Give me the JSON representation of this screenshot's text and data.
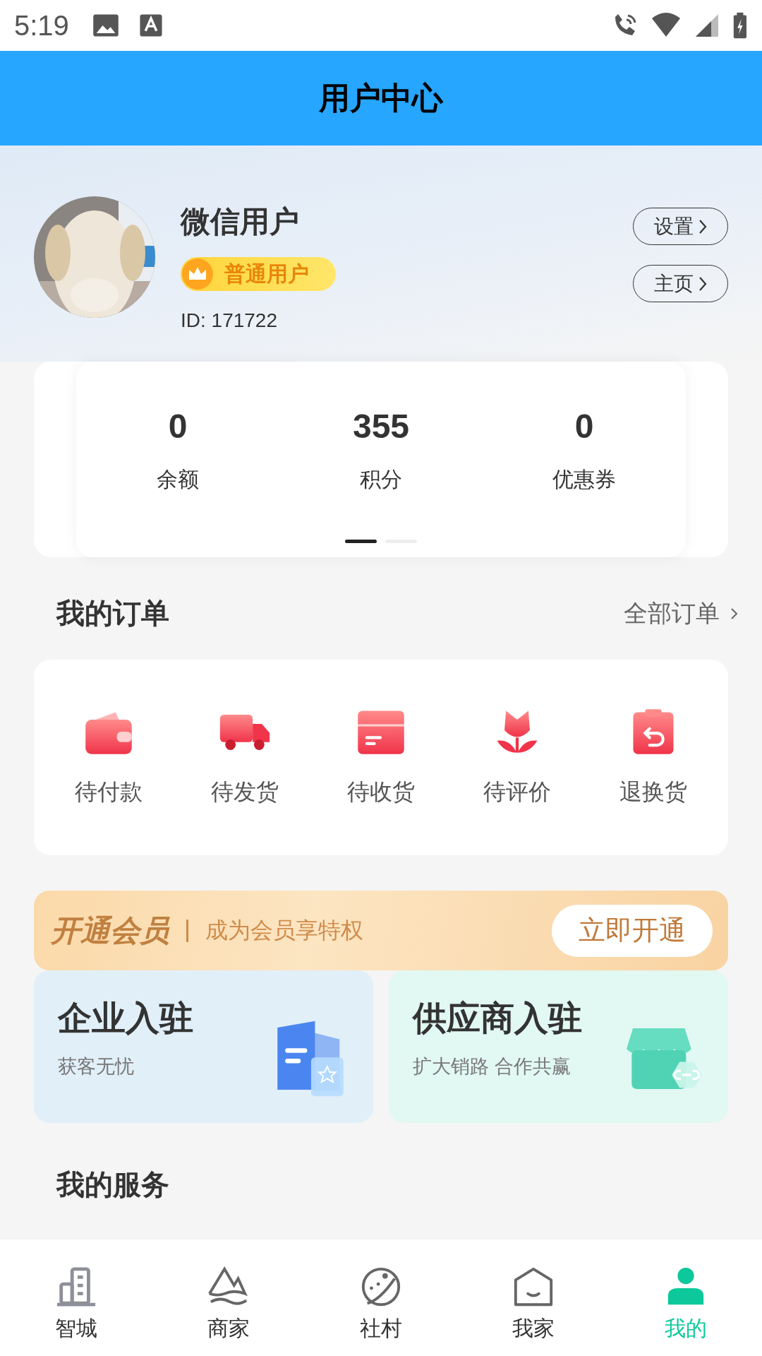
{
  "status_bar": {
    "time": "5:19"
  },
  "header": {
    "title": "用户中心"
  },
  "profile": {
    "name": "微信用户",
    "badge": "普通用户",
    "id_text": "ID: 171722",
    "buttons": [
      {
        "label": "设置"
      },
      {
        "label": "主页"
      }
    ]
  },
  "stats": {
    "items": [
      {
        "value": "0",
        "label": "余额"
      },
      {
        "value": "355",
        "label": "积分"
      },
      {
        "value": "0",
        "label": "优惠券"
      }
    ],
    "pages": [
      {
        "selected": true
      },
      {
        "selected": false
      }
    ]
  },
  "orders": {
    "title": "我的订单",
    "all_link": "全部订单",
    "items": [
      {
        "label": "待付款",
        "kind": "wallet"
      },
      {
        "label": "待发货",
        "kind": "truck"
      },
      {
        "label": "待收货",
        "kind": "box"
      },
      {
        "label": "待评价",
        "kind": "flower"
      },
      {
        "label": "退换货",
        "kind": "return"
      }
    ]
  },
  "vip_banner": {
    "title": "开通会员",
    "subtitle": "成为会员享特权",
    "button": "立即开通"
  },
  "entry_cards": [
    {
      "title": "企业入驻",
      "subtitle": "获客无忧",
      "kind": "enterprise"
    },
    {
      "title": "供应商入驻",
      "subtitle": "扩大销路 合作共赢",
      "kind": "supplier"
    }
  ],
  "services": {
    "title": "我的服务"
  },
  "nav": {
    "items": [
      {
        "label": "智城",
        "kind": "city",
        "selected": false
      },
      {
        "label": "商家",
        "kind": "mountain",
        "selected": false
      },
      {
        "label": "社村",
        "kind": "planet",
        "selected": false
      },
      {
        "label": "我家",
        "kind": "house",
        "selected": false
      },
      {
        "label": "我的",
        "kind": "person",
        "selected": true
      }
    ]
  }
}
